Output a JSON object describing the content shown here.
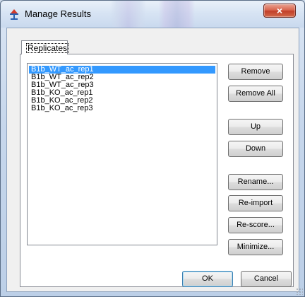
{
  "window": {
    "title": "Manage Results",
    "close_label": "×"
  },
  "tabs": [
    {
      "label": "Replicates"
    }
  ],
  "replicates": {
    "items": [
      "B1b_WT_ac_rep1",
      "B1b_WT_ac_rep2",
      "B1b_WT_ac_rep3",
      "B1b_KO_ac_rep1",
      "B1b_KO_ac_rep2",
      "B1b_KO_ac_rep3"
    ],
    "selected_index": 0
  },
  "buttons": {
    "remove": "Remove",
    "remove_all": "Remove All",
    "up": "Up",
    "down": "Down",
    "rename": "Rename...",
    "reimport": "Re-import",
    "rescore": "Re-score...",
    "minimize": "Minimize...",
    "ok": "OK",
    "cancel": "Cancel"
  },
  "colors": {
    "selection": "#3399ff",
    "close_button": "#c2402a"
  },
  "icons": {
    "app": "scales-app-icon",
    "close": "close-icon"
  }
}
